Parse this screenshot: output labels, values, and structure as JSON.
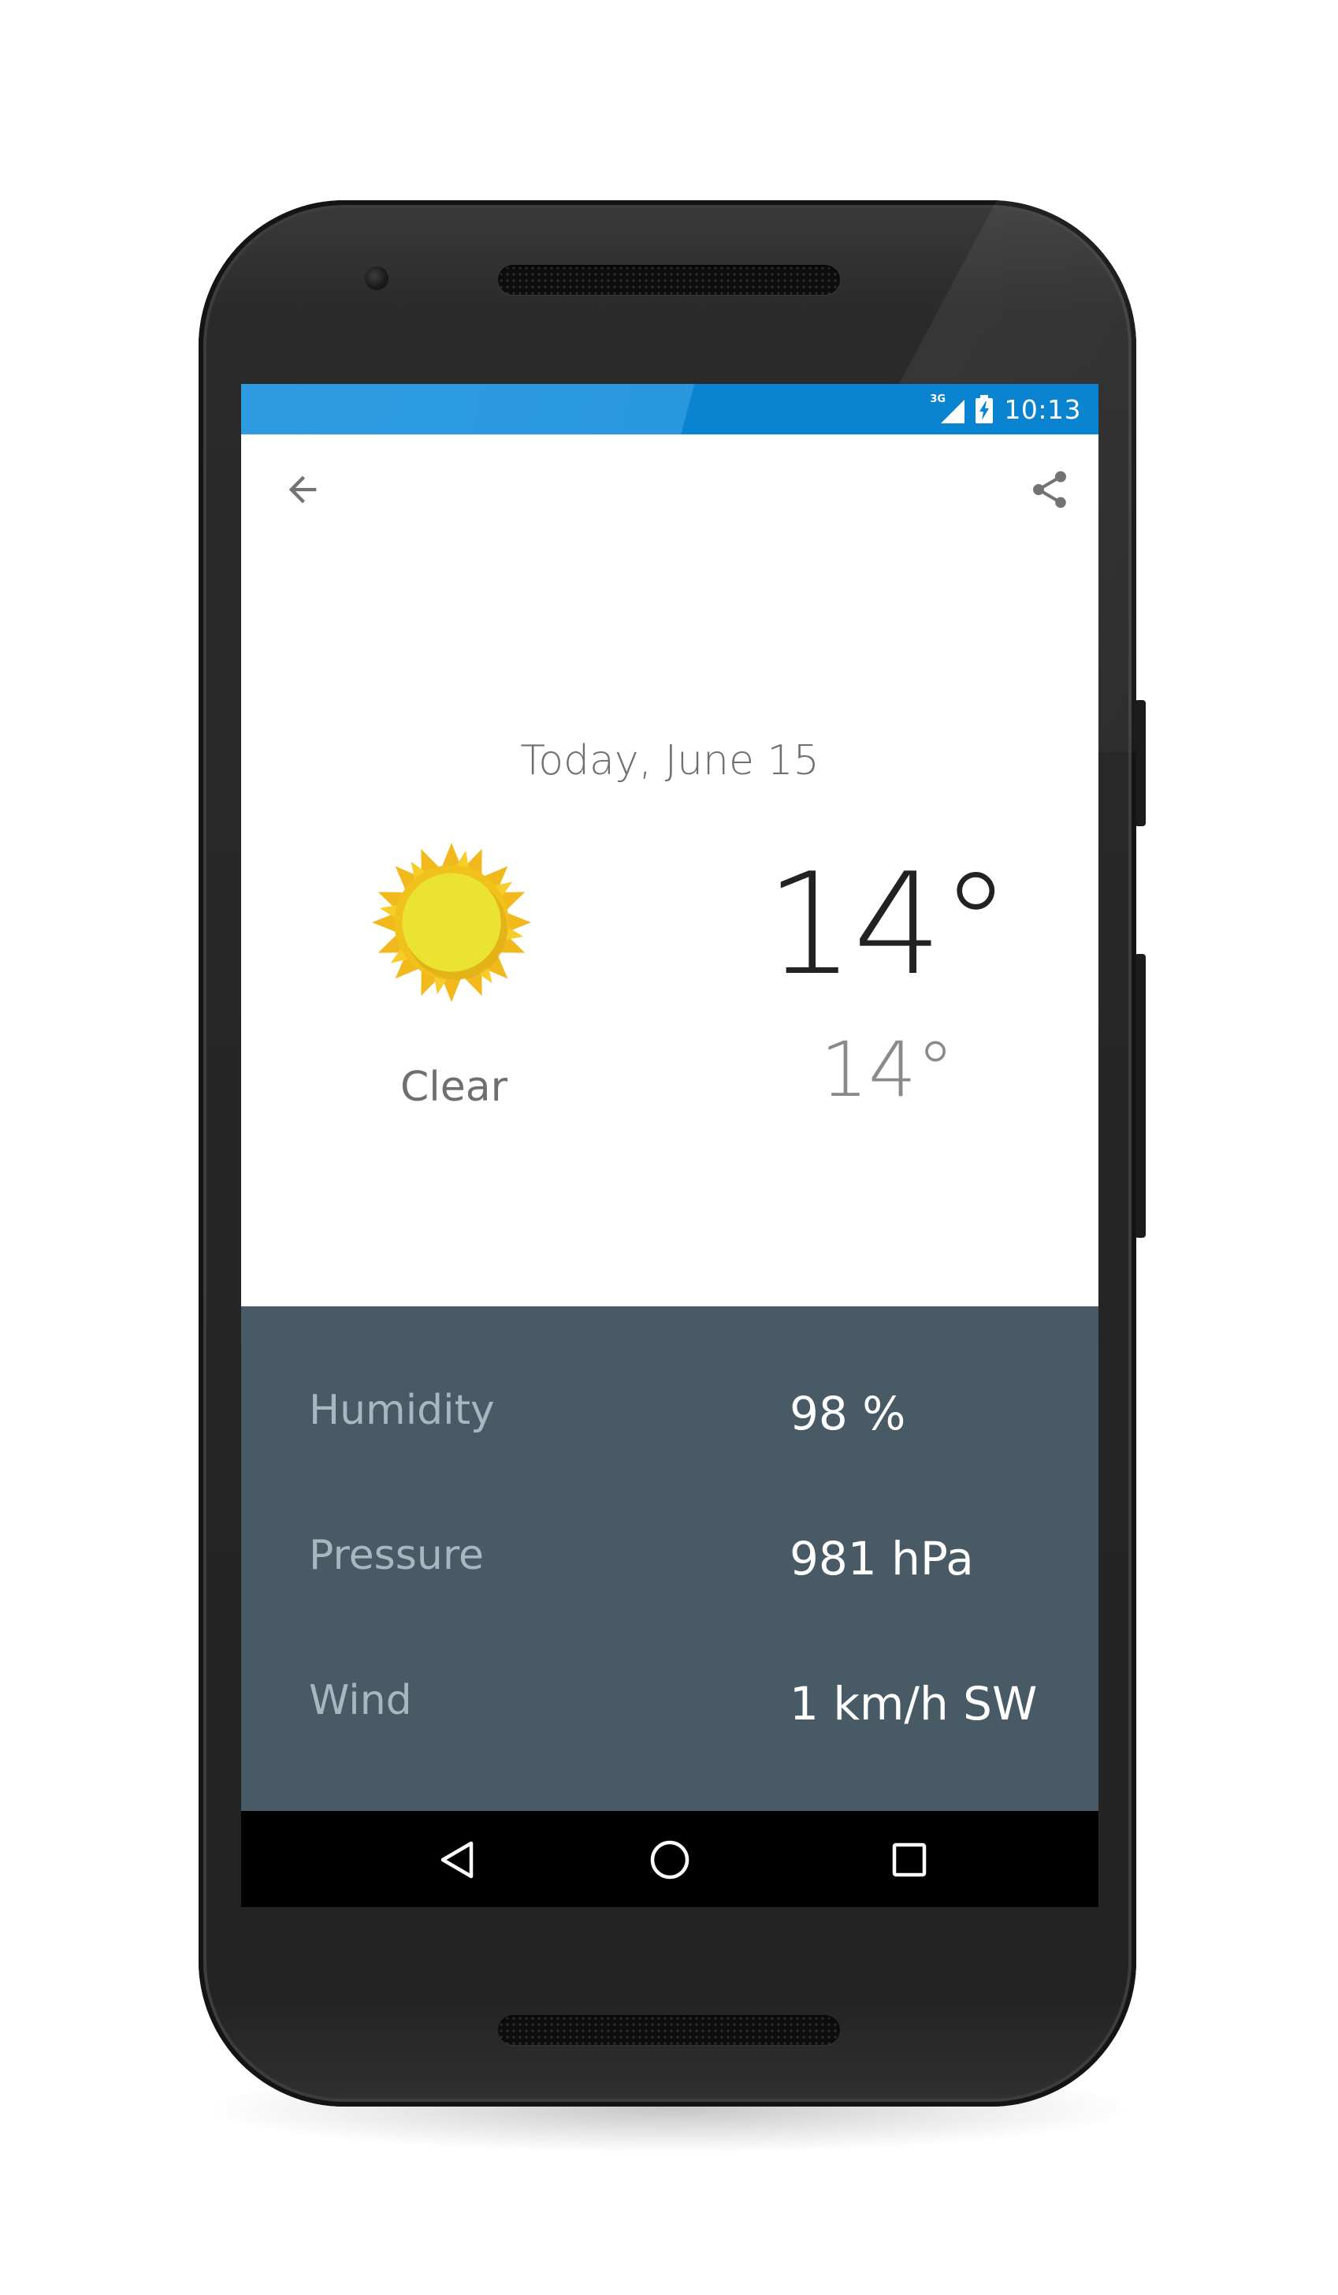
{
  "status_bar": {
    "network_type": "3G",
    "time": "10:13",
    "signal_icon": "cellular-signal-icon",
    "battery_icon": "battery-charging-icon",
    "color_light": "#2e9be0",
    "color_dark": "#0a84d1"
  },
  "app_bar": {
    "back_icon": "arrow-back-icon",
    "share_icon": "share-icon"
  },
  "forecast": {
    "date": "Today, June 15",
    "condition": "Clear",
    "condition_icon": "sun-icon",
    "high": "14°",
    "low": "14°"
  },
  "details": {
    "background_color": "#475a66",
    "rows": [
      {
        "label": "Humidity",
        "value": "98 %"
      },
      {
        "label": "Pressure",
        "value": "981 hPa"
      },
      {
        "label": "Wind",
        "value": "1 km/h SW"
      }
    ]
  },
  "nav_bar": {
    "back_icon": "nav-back-triangle-icon",
    "home_icon": "nav-home-circle-icon",
    "recents_icon": "nav-recents-square-icon"
  }
}
